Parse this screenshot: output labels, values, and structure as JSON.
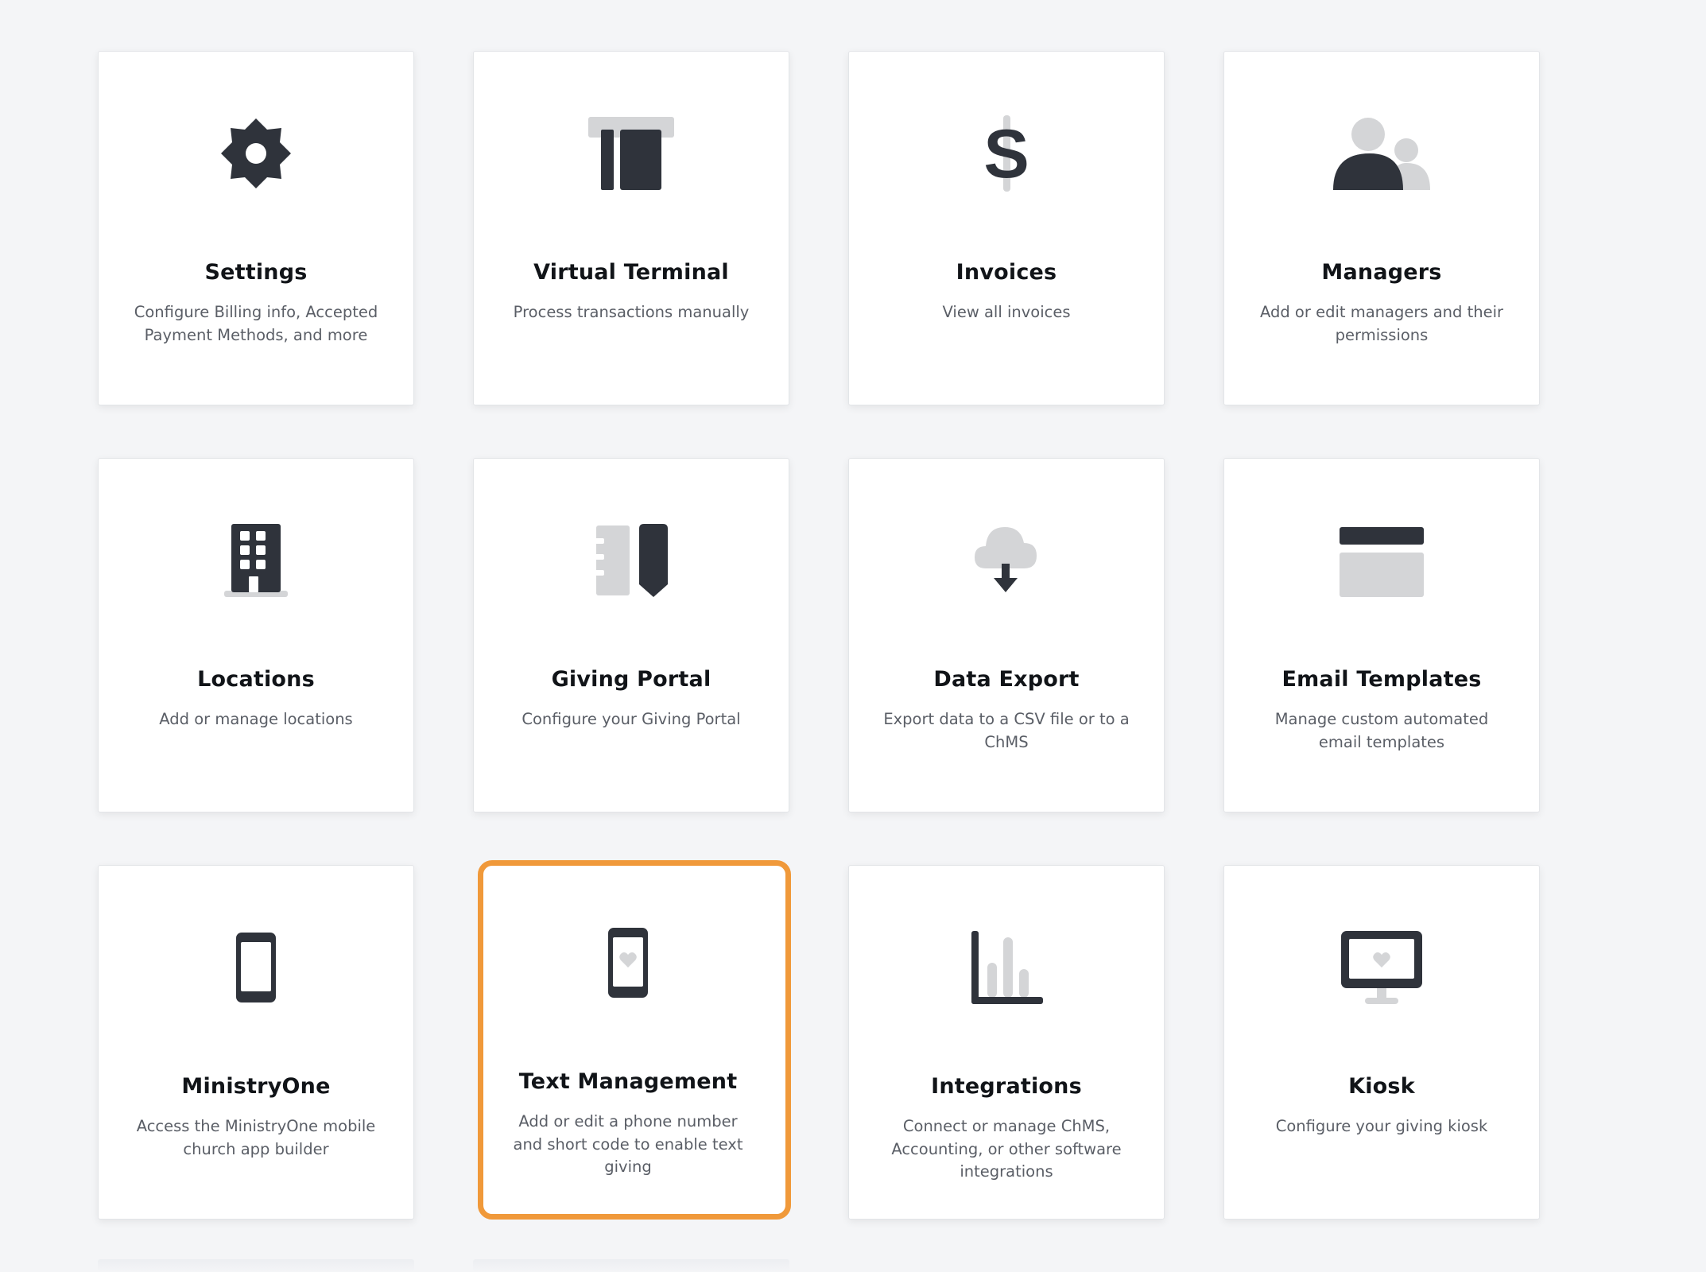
{
  "cards": [
    {
      "title": "Settings",
      "description": "Configure Billing info, Accepted Payment Methods, and more",
      "icon": "gear-icon"
    },
    {
      "title": "Virtual Terminal",
      "description": "Process transactions manually",
      "icon": "terminal-icon"
    },
    {
      "title": "Invoices",
      "description": "View all invoices",
      "icon": "dollar-icon"
    },
    {
      "title": "Managers",
      "description": "Add or edit managers and their permissions",
      "icon": "users-icon"
    },
    {
      "title": "Locations",
      "description": "Add or manage locations",
      "icon": "building-icon"
    },
    {
      "title": "Giving Portal",
      "description": "Configure your Giving Portal",
      "icon": "portal-icon"
    },
    {
      "title": "Data Export",
      "description": "Export data to a CSV file or to a ChMS",
      "icon": "cloud-download-icon"
    },
    {
      "title": "Email Templates",
      "description": "Manage custom automated email templates",
      "icon": "email-template-icon"
    },
    {
      "title": "MinistryOne",
      "description": "Access the MinistryOne mobile church app builder",
      "icon": "mobile-phone-icon"
    },
    {
      "title": "Text Management",
      "description": "Add or edit a phone number and short code to enable text giving",
      "icon": "phone-heart-icon"
    },
    {
      "title": "Integrations",
      "description": "Connect or manage ChMS, Accounting, or other software integrations",
      "icon": "bar-chart-icon"
    },
    {
      "title": "Kiosk",
      "description": "Configure your giving kiosk",
      "icon": "kiosk-monitor-icon"
    }
  ],
  "colors": {
    "icon_dark": "#2f333b",
    "icon_light": "#d4d5d7",
    "highlight": "#f0993a"
  }
}
